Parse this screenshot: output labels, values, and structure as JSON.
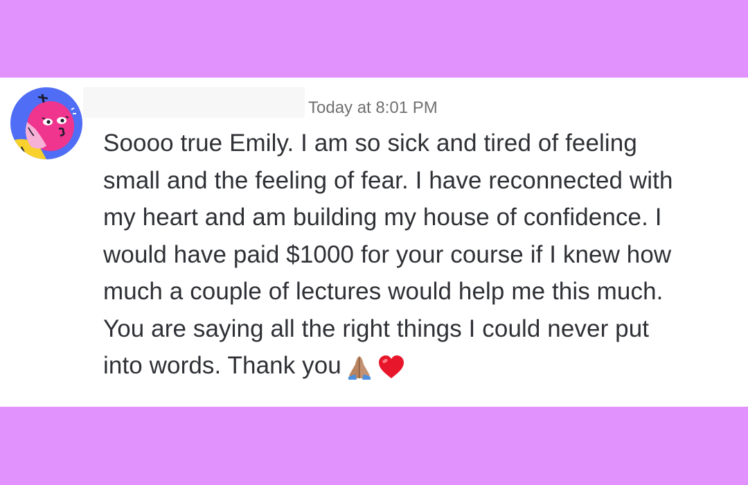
{
  "message": {
    "author_name": "",
    "timestamp": "Today at 8:01 PM",
    "lines": [
      "Soooo true Emily. I am so sick and tired of feeling",
      "small and the feeling of fear. I have reconnected with",
      "my heart and am building my house of confidence. I",
      "would have paid $1000 for your course if I knew how",
      "much a couple of lectures would help me this much.",
      "You are saying all the right things I could never put",
      "into words. Thank you"
    ],
    "emojis": [
      "folded-hands-icon",
      "red-heart-icon"
    ]
  },
  "colors": {
    "background": "#e292fd",
    "card": "#ffffff",
    "text": "#2e3035",
    "timestamp": "#707070",
    "avatar_bg": "#4f6df5",
    "avatar_face": "#f0358e"
  }
}
